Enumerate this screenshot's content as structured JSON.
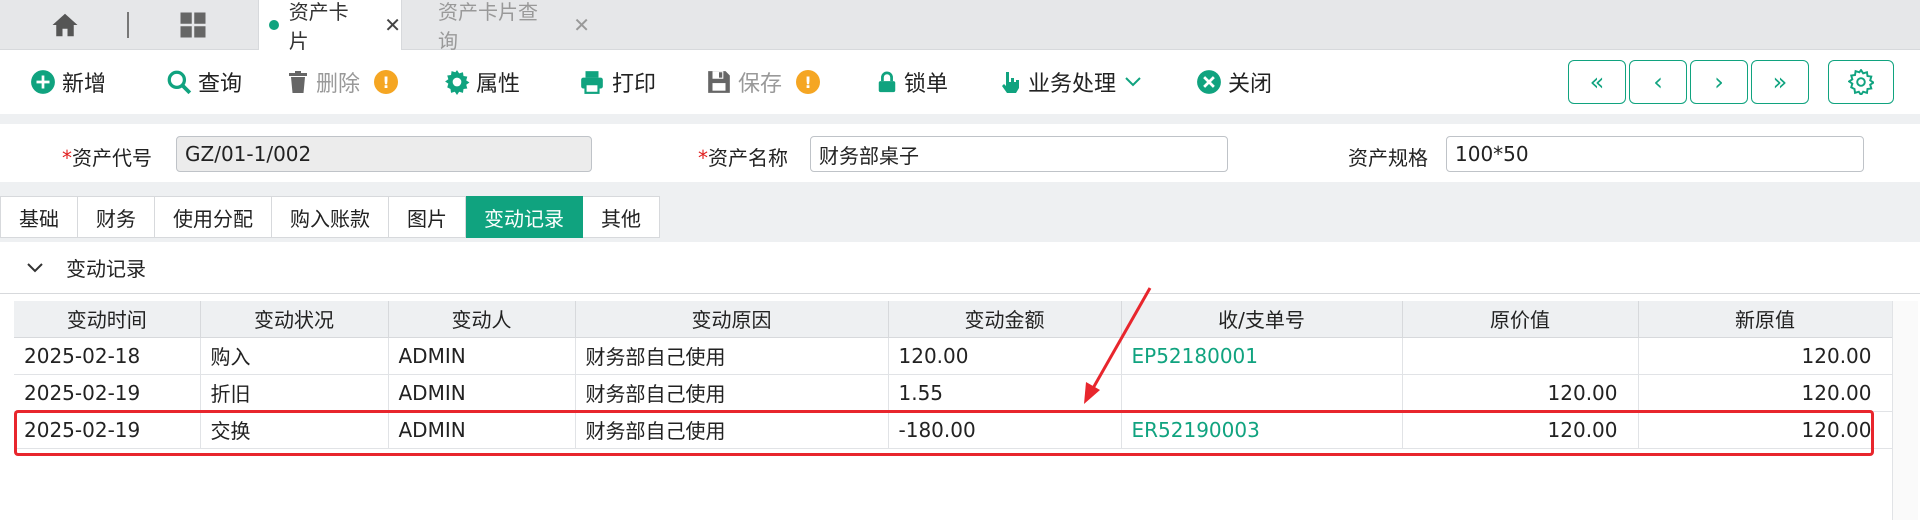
{
  "top_tabs": [
    {
      "label": "资产卡片",
      "active": true
    },
    {
      "label": "资产卡片查询",
      "active": false
    }
  ],
  "toolbar": {
    "add": "新增",
    "query": "查询",
    "delete": "删除",
    "properties": "属性",
    "print": "打印",
    "save": "保存",
    "lock": "锁单",
    "business": "业务处理",
    "close": "关闭",
    "warn_symbol": "!"
  },
  "nav": {
    "first": "«",
    "prev": "‹",
    "next": "›",
    "last": "»"
  },
  "fields": {
    "code_label": "资产代号",
    "code_value": "GZ/01-1/002",
    "name_label": "资产名称",
    "name_value": "财务部桌子",
    "spec_label": "资产规格",
    "spec_value": "100*50",
    "required_mark": "*"
  },
  "sub_tabs": [
    "基础",
    "财务",
    "使用分配",
    "购入账款",
    "图片",
    "变动记录",
    "其他"
  ],
  "active_sub_tab": "变动记录",
  "section_title": "变动记录",
  "table": {
    "headers": [
      "变动时间",
      "变动状况",
      "变动人",
      "变动原因",
      "变动金额",
      "收/支单号",
      "原价值",
      "新原值"
    ],
    "rows": [
      [
        "2025-02-18",
        "购入",
        "ADMIN",
        "财务部自己使用",
        "120.00",
        "EP52180001",
        "",
        "120.00"
      ],
      [
        "2025-02-19",
        "折旧",
        "ADMIN",
        "财务部自己使用",
        "1.55",
        "",
        "120.00",
        "120.00"
      ],
      [
        "2025-02-19",
        "交换",
        "ADMIN",
        "财务部自己使用",
        "-180.00",
        "ER52190003",
        "120.00",
        "120.00"
      ]
    ]
  },
  "colors": {
    "accent": "#10a37f",
    "highlight": "#e8262d",
    "warning": "#f5a623"
  }
}
